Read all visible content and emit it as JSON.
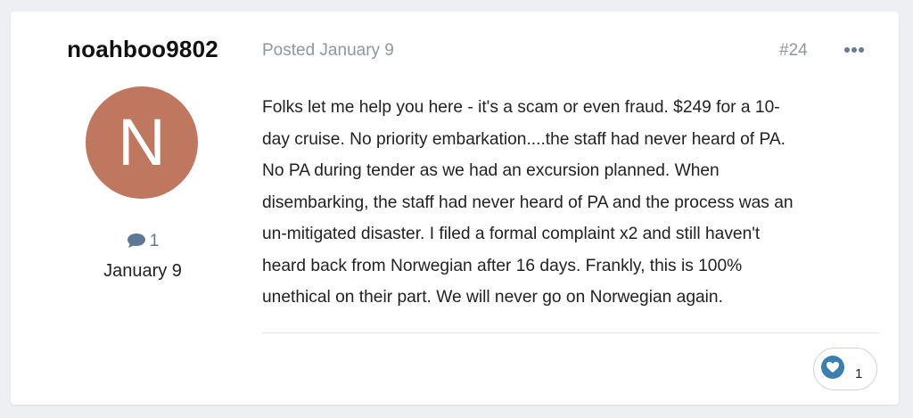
{
  "author": {
    "name": "noahboo9802",
    "avatar_letter": "N",
    "avatar_color": "#c0775f",
    "post_count": "1",
    "joined": "January 9"
  },
  "post": {
    "posted": "Posted January 9",
    "number": "#24",
    "body": "Folks let me help you here - it's a scam or even fraud.  $249 for a 10-\nday cruise.  No priority embarkation....the staff had never heard of PA.\nNo PA during tender as we had an excursion planned.  When\ndisembarking, the staff had never heard of PA and the process was an\nun-mitigated disaster.  I filed a formal complaint x2 and still haven't\nheard back from Norwegian after 16 days.  Frankly, this is 100%\nunethical on their part.  We will never go on Norwegian again.",
    "reaction_count": "1",
    "reaction_icon": "heart-icon",
    "reaction_color": "#3d7eb0"
  }
}
